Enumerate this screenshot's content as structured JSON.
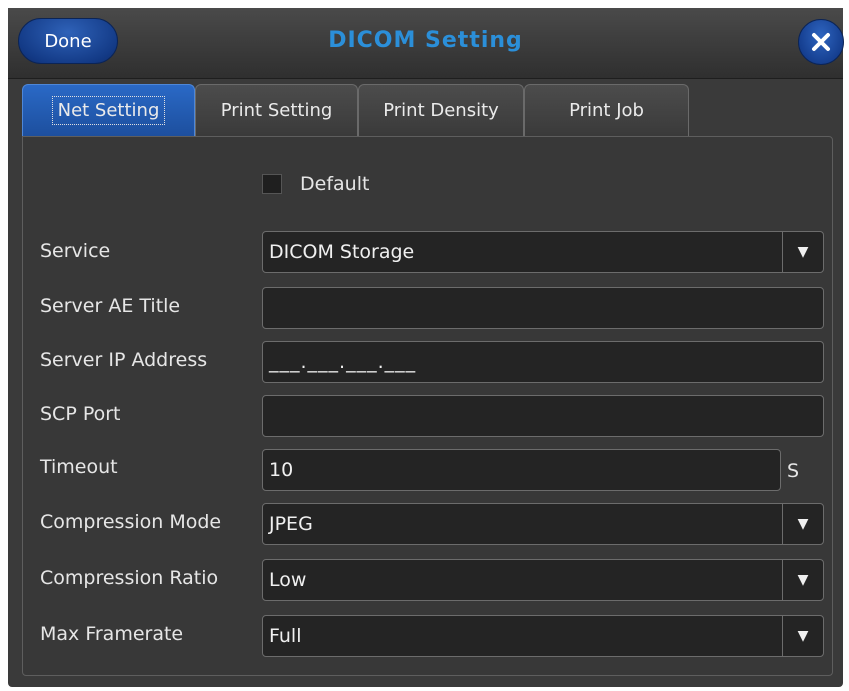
{
  "header": {
    "done_label": "Done",
    "title": "DICOM Setting",
    "close_icon": "close-icon"
  },
  "tabs": [
    {
      "label": "Net Setting",
      "active": true
    },
    {
      "label": "Print Setting",
      "active": false
    },
    {
      "label": "Print Density",
      "active": false
    },
    {
      "label": "Print Job",
      "active": false
    }
  ],
  "form": {
    "default_label": "Default",
    "default_checked": false,
    "service": {
      "label": "Service",
      "value": "DICOM Storage"
    },
    "server_ae_title": {
      "label": "Server AE Title",
      "value": ""
    },
    "server_ip": {
      "label": "Server IP Address",
      "value": "___.___.___.___"
    },
    "scp_port": {
      "label": "SCP Port",
      "value": ""
    },
    "timeout": {
      "label": "Timeout",
      "value": "10",
      "unit": "S"
    },
    "compression_mode": {
      "label": "Compression Mode",
      "value": "JPEG"
    },
    "compression_ratio": {
      "label": "Compression Ratio",
      "value": "Low"
    },
    "max_framerate": {
      "label": "Max Framerate",
      "value": "Full"
    }
  },
  "colors": {
    "accent": "#2b8fd9",
    "button_blue": "#133a86",
    "background": "#3a3a3a"
  }
}
